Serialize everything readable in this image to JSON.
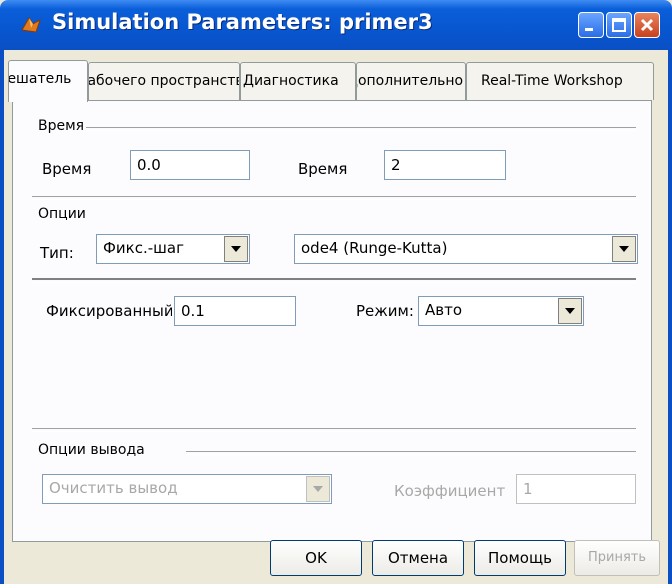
{
  "window": {
    "title": "Simulation Parameters: primer3"
  },
  "tabs": [
    {
      "label": "Решатель"
    },
    {
      "label": "Рабочего пространства"
    },
    {
      "label": "Диагностика"
    },
    {
      "label": "Дополнительно"
    },
    {
      "label": "Real-Time Workshop"
    }
  ],
  "time_group": {
    "title": "Время",
    "start_label": "Время",
    "start_value": "0.0",
    "stop_label": "Время",
    "stop_value": "2"
  },
  "options_group": {
    "title": "Опции",
    "type_label": "Тип:",
    "type_value": "Фикс.-шаг",
    "solver_value": "ode4 (Runge-Kutta)",
    "step_label": "Фиксированный",
    "step_value": "0.1",
    "mode_label": "Режим:",
    "mode_value": "Авто"
  },
  "output_group": {
    "title": "Опции вывода",
    "output_value": "Очистить вывод",
    "coef_label": "Коэффициент",
    "coef_value": "1"
  },
  "buttons": {
    "ok": "OK",
    "cancel": "Отмена",
    "help": "Помощь",
    "apply": "Принять"
  }
}
